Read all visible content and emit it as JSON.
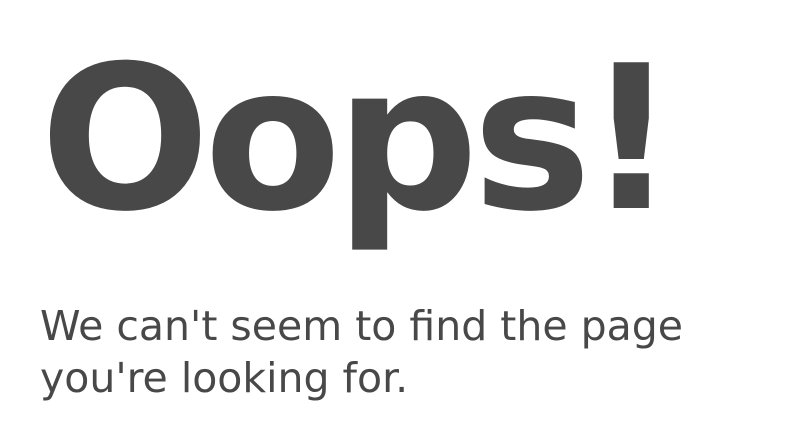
{
  "error_page": {
    "headline": "Oops!",
    "message_line_1": "We can't seem to find the page",
    "message_line_2": "you're looking for."
  },
  "colors": {
    "text": "#484848",
    "background": "#ffffff"
  }
}
